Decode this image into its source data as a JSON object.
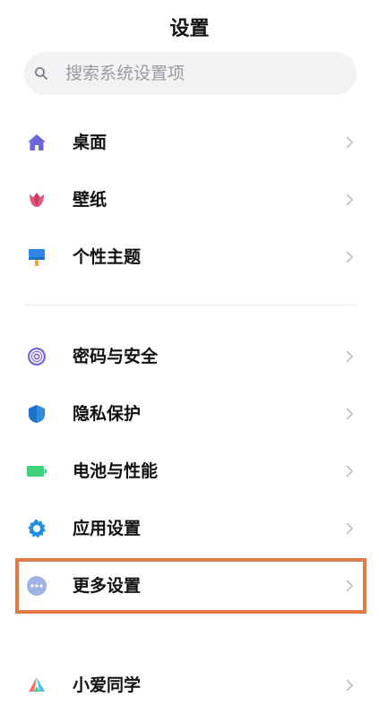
{
  "header": {
    "title": "设置"
  },
  "search": {
    "placeholder": "搜索系统设置项"
  },
  "items": [
    {
      "label": "桌面",
      "icon": "home-icon",
      "color": "#6b66d9"
    },
    {
      "label": "壁纸",
      "icon": "tulip-icon",
      "color": "#e4597a"
    },
    {
      "label": "个性主题",
      "icon": "paint-roller-icon",
      "color": "#2f86e6"
    },
    {
      "label": "密码与安全",
      "icon": "fingerprint-icon",
      "color": "#7a63d8"
    },
    {
      "label": "隐私保护",
      "icon": "shield-icon",
      "color": "#2e8ce0"
    },
    {
      "label": "电池与性能",
      "icon": "battery-icon",
      "color": "#3fd07a"
    },
    {
      "label": "应用设置",
      "icon": "gear-icon",
      "color": "#1f8fe0"
    },
    {
      "label": "更多设置",
      "icon": "more-dots-icon",
      "color": "#9fb2e3"
    },
    {
      "label": "小爱同学",
      "icon": "xiaoai-icon",
      "color": "#4cc0f0"
    }
  ],
  "highlight_color": "#e4794a"
}
